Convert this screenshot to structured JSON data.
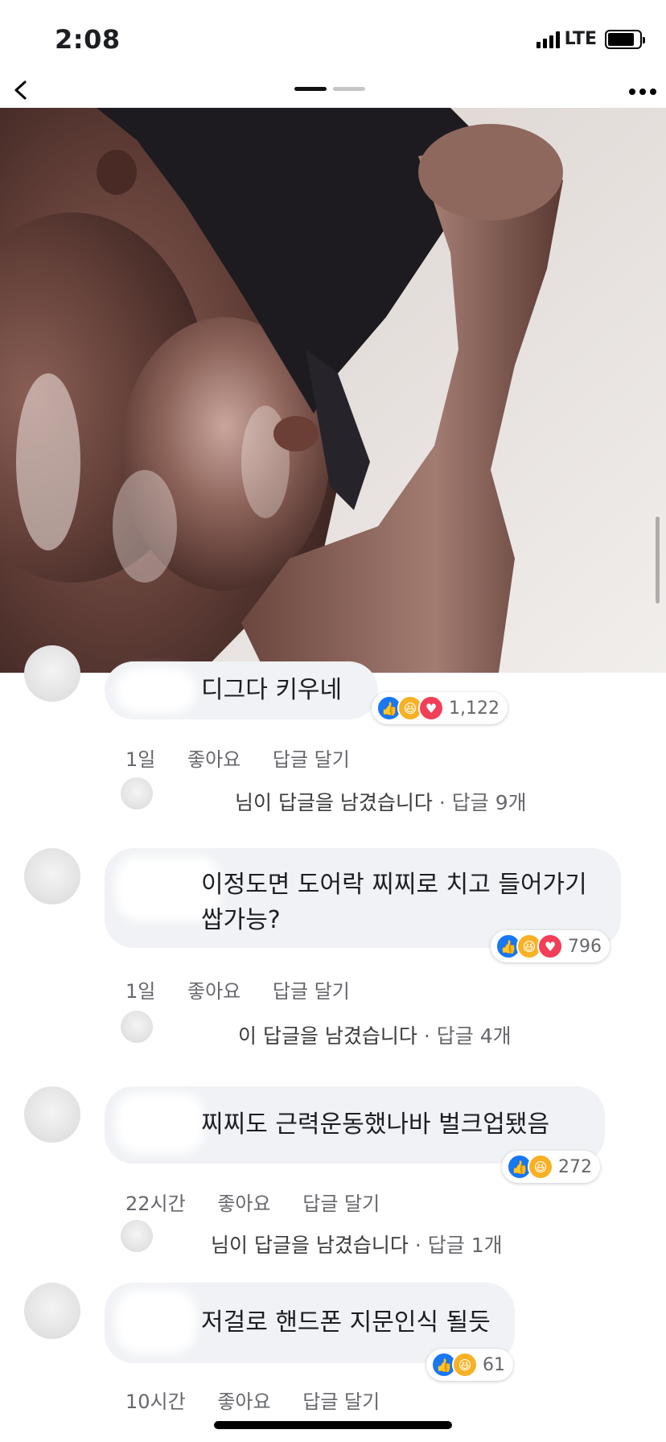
{
  "status_bar": {
    "time": "2:08",
    "network": "LTE"
  },
  "comments": [
    {
      "text": "디그다 키우네",
      "reactions": [
        "like",
        "haha",
        "love"
      ],
      "reaction_count": "1,122",
      "time": "1일",
      "like_label": "좋아요",
      "reply_label": "답글 달기",
      "replies_text": "님이 답글을 남겼습니다",
      "replies_count": "· 답글 9개"
    },
    {
      "text": "이정도면 도어락 찌찌로 치고 들어가기 쌉가능?",
      "reactions": [
        "like",
        "haha",
        "love"
      ],
      "reaction_count": "796",
      "time": "1일",
      "like_label": "좋아요",
      "reply_label": "답글 달기",
      "replies_text": "이 답글을 남겼습니다",
      "replies_count": "· 답글 4개"
    },
    {
      "text": "찌찌도 근력운동했나바 벌크업됐음",
      "reactions": [
        "like",
        "haha"
      ],
      "reaction_count": "272",
      "time": "22시간",
      "like_label": "좋아요",
      "reply_label": "답글 달기",
      "replies_text": "님이 답글을 남겼습니다",
      "replies_count": "· 답글 1개"
    },
    {
      "text": "저걸로 핸드폰 지문인식 될듯",
      "reactions": [
        "like",
        "haha"
      ],
      "reaction_count": "61",
      "time": "10시간",
      "like_label": "좋아요",
      "reply_label": "답글 달기"
    }
  ],
  "colors": {
    "like": "#1877f2",
    "haha": "#f7b125",
    "love": "#f33e58",
    "bubble": "#f0f2f5",
    "meta": "#65676b"
  },
  "icons": {
    "back": "chevron-left-icon",
    "more": "more-horizontal-icon",
    "like": "thumbs-up-icon",
    "haha": "laughing-face-icon",
    "love": "heart-icon"
  }
}
